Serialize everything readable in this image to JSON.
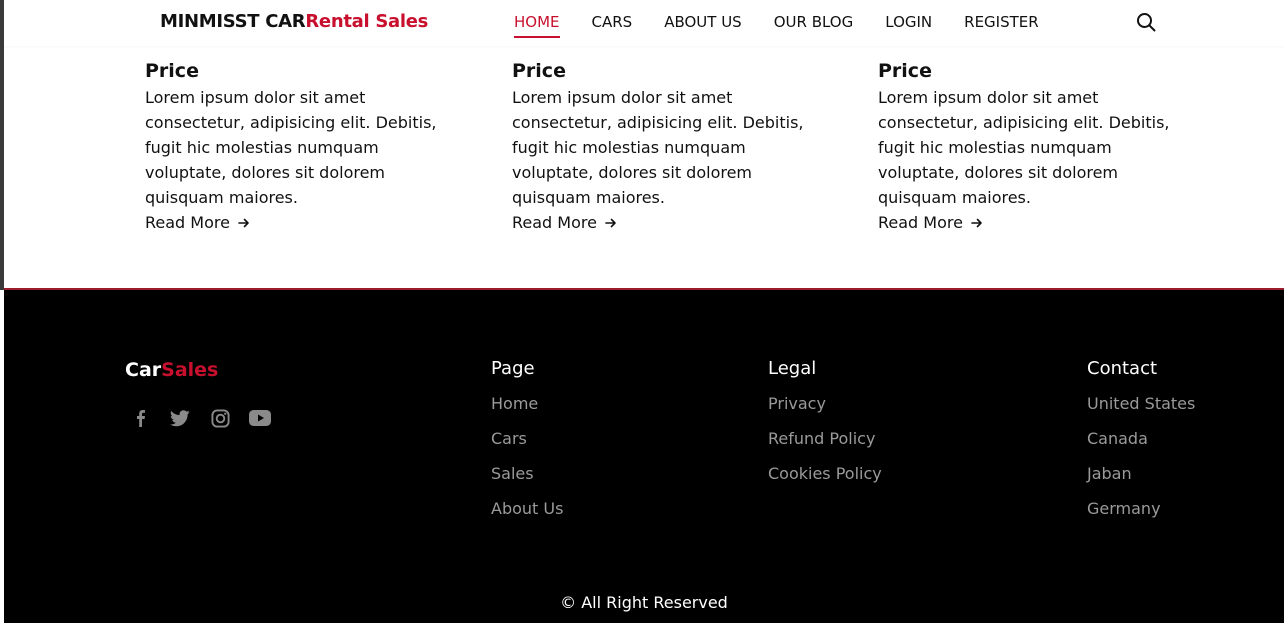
{
  "header": {
    "brand_part1": "MINMISST CAR",
    "brand_part2": "Rental Sales",
    "nav": [
      {
        "label": "HOME"
      },
      {
        "label": "CARS"
      },
      {
        "label": "ABOUT US"
      },
      {
        "label": "OUR BLOG"
      },
      {
        "label": "LOGIN"
      },
      {
        "label": "REGISTER"
      }
    ],
    "search_icon": "search-icon"
  },
  "cards": [
    {
      "title": "Price",
      "text": "Lorem ipsum dolor sit amet consectetur, adipisicing elit. Debitis, fugit hic molestias numquam voluptate, dolores sit dolorem quisquam maiores.",
      "link": "Read More"
    },
    {
      "title": "Price",
      "text": "Lorem ipsum dolor sit amet consectetur, adipisicing elit. Debitis, fugit hic molestias numquam voluptate, dolores sit dolorem quisquam maiores.",
      "link": "Read More"
    },
    {
      "title": "Price",
      "text": "Lorem ipsum dolor sit amet consectetur, adipisicing elit. Debitis, fugit hic molestias numquam voluptate, dolores sit dolorem quisquam maiores.",
      "link": "Read More"
    }
  ],
  "footer": {
    "logo_part1": "Car",
    "logo_part2": "Sales",
    "socials": [
      "facebook-icon",
      "twitter-icon",
      "instagram-icon",
      "youtube-icon"
    ],
    "columns": [
      {
        "title": "Page",
        "links": [
          "Home",
          "Cars",
          "Sales",
          "About Us"
        ]
      },
      {
        "title": "Legal",
        "links": [
          "Privacy",
          "Refund Policy",
          "Cookies Policy"
        ]
      },
      {
        "title": "Contact",
        "links": [
          "United States",
          "Canada",
          "Jaban",
          "Germany"
        ]
      }
    ],
    "copyright": "© All Right Reserved"
  },
  "colors": {
    "accent": "#c8102e",
    "footer_bg": "#000000",
    "footer_link": "#9a9a9a"
  }
}
